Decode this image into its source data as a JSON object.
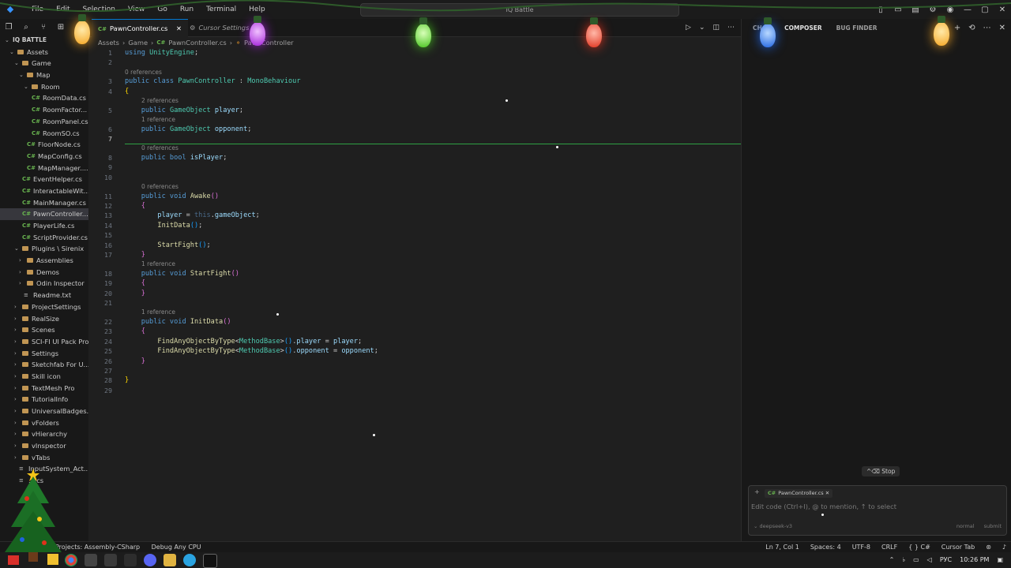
{
  "titlebar": {
    "menu": [
      "File",
      "Edit",
      "Selection",
      "View",
      "Go",
      "Run",
      "Terminal",
      "Help"
    ],
    "search": "IQ Battle"
  },
  "explorer": {
    "rows": [
      {
        "indent": 0,
        "kind": "root",
        "label": "IQ BATTLE",
        "open": true
      },
      {
        "indent": 1,
        "kind": "folder",
        "label": "Assets",
        "open": true
      },
      {
        "indent": 2,
        "kind": "folder",
        "label": "Game",
        "open": true
      },
      {
        "indent": 3,
        "kind": "folder",
        "label": "Map",
        "open": true
      },
      {
        "indent": 4,
        "kind": "folder",
        "label": "Room",
        "open": true
      },
      {
        "indent": 5,
        "kind": "cs",
        "label": "RoomData.cs"
      },
      {
        "indent": 5,
        "kind": "cs",
        "label": "RoomFactor..."
      },
      {
        "indent": 5,
        "kind": "cs",
        "label": "RoomPanel.cs"
      },
      {
        "indent": 5,
        "kind": "cs",
        "label": "RoomSO.cs"
      },
      {
        "indent": 4,
        "kind": "cs",
        "label": "FloorNode.cs"
      },
      {
        "indent": 4,
        "kind": "cs",
        "label": "MapConfig.cs"
      },
      {
        "indent": 4,
        "kind": "cs",
        "label": "MapManager...."
      },
      {
        "indent": 3,
        "kind": "cs",
        "label": "EventHelper.cs"
      },
      {
        "indent": 3,
        "kind": "cs",
        "label": "InteractableWit..."
      },
      {
        "indent": 3,
        "kind": "cs",
        "label": "MainManager.cs"
      },
      {
        "indent": 3,
        "kind": "cs",
        "label": "PawnController...",
        "selected": true
      },
      {
        "indent": 3,
        "kind": "cs",
        "label": "PlayerLife.cs"
      },
      {
        "indent": 3,
        "kind": "cs",
        "label": "ScriptProvider.cs"
      },
      {
        "indent": 2,
        "kind": "folder",
        "label": "Plugins \\ Sirenix",
        "open": true
      },
      {
        "indent": 3,
        "kind": "folder",
        "label": "Assemblies"
      },
      {
        "indent": 3,
        "kind": "folder",
        "label": "Demos"
      },
      {
        "indent": 3,
        "kind": "folder",
        "label": "Odin Inspector"
      },
      {
        "indent": 3,
        "kind": "file",
        "label": "Readme.txt"
      },
      {
        "indent": 2,
        "kind": "folder",
        "label": "ProjectSettings"
      },
      {
        "indent": 2,
        "kind": "folder",
        "label": "RealSize"
      },
      {
        "indent": 2,
        "kind": "folder",
        "label": "Scenes"
      },
      {
        "indent": 2,
        "kind": "folder",
        "label": "SCI-FI UI Pack Pro"
      },
      {
        "indent": 2,
        "kind": "folder",
        "label": "Settings"
      },
      {
        "indent": 2,
        "kind": "folder",
        "label": "Sketchfab For U..."
      },
      {
        "indent": 2,
        "kind": "folder",
        "label": "Skill icon"
      },
      {
        "indent": 2,
        "kind": "folder",
        "label": "TextMesh Pro"
      },
      {
        "indent": 2,
        "kind": "folder",
        "label": "TutorialInfo"
      },
      {
        "indent": 2,
        "kind": "folder",
        "label": "UniversalBadges..."
      },
      {
        "indent": 2,
        "kind": "folder",
        "label": "vFolders"
      },
      {
        "indent": 2,
        "kind": "folder",
        "label": "vHierarchy"
      },
      {
        "indent": 2,
        "kind": "folder",
        "label": "vInspector"
      },
      {
        "indent": 2,
        "kind": "folder",
        "label": "vTabs"
      },
      {
        "indent": 2,
        "kind": "file",
        "label": "InputSystem_Act..."
      },
      {
        "indent": 2,
        "kind": "file",
        "label": "...ics"
      }
    ]
  },
  "tabs": {
    "active": "PawnController.cs",
    "inactive": "Cursor Settings"
  },
  "breadcrumb": [
    "Assets",
    "Game",
    "PawnController.cs",
    "PawnController"
  ],
  "editor": {
    "lines": [
      {
        "n": "1",
        "html": "<span class=\"kw\">using</span> <span class=\"ty\">UnityEngine</span>;"
      },
      {
        "n": "2",
        "html": ""
      },
      {
        "n": "3",
        "lens": "0 references",
        "html": "<span class=\"kw\">public class</span> <span class=\"ty\">PawnController</span> : <span class=\"ty\">MonoBehaviour</span>"
      },
      {
        "n": "4",
        "html": "<span class=\"br\">{</span>"
      },
      {
        "n": "5",
        "lens": "2 references",
        "html": "    <span class=\"kw\">public</span> <span class=\"ty\">GameObject</span> <span class=\"var\">player</span>;"
      },
      {
        "n": "6",
        "lens": "1 reference",
        "html": "    <span class=\"kw\">public</span> <span class=\"ty\">GameObject</span> <span class=\"var\">opponent</span>;"
      },
      {
        "n": "7",
        "html": "",
        "current": true
      },
      {
        "n": "8",
        "lens": "0 references",
        "html": "    <span class=\"kw\">public bool</span> <span class=\"var\">isPlayer</span>;"
      },
      {
        "n": "9",
        "html": ""
      },
      {
        "n": "10",
        "html": ""
      },
      {
        "n": "11",
        "lens": "0 references",
        "html": "    <span class=\"kw\">public void</span> <span class=\"fn\">Awake</span><span class=\"br2\">()</span>"
      },
      {
        "n": "12",
        "html": "    <span class=\"br2\">{</span>"
      },
      {
        "n": "13",
        "html": "        <span class=\"var\">player</span> = <span class=\"dim\">this</span>.<span class=\"var\">gameObject</span>;"
      },
      {
        "n": "14",
        "html": "        <span class=\"fn\">InitData</span><span class=\"br3\">()</span>;"
      },
      {
        "n": "15",
        "html": ""
      },
      {
        "n": "16",
        "html": "        <span class=\"fn\">StartFight</span><span class=\"br3\">()</span>;"
      },
      {
        "n": "17",
        "html": "    <span class=\"br2\">}</span>"
      },
      {
        "n": "18",
        "lens": "1 reference",
        "html": "    <span class=\"kw\">public void</span> <span class=\"fn\">StartFight</span><span class=\"br2\">()</span>"
      },
      {
        "n": "19",
        "html": "    <span class=\"br2\">{</span>"
      },
      {
        "n": "20",
        "html": "    <span class=\"br2\">}</span>"
      },
      {
        "n": "21",
        "html": ""
      },
      {
        "n": "22",
        "lens": "1 reference",
        "html": "    <span class=\"kw\">public void</span> <span class=\"fn\">InitData</span><span class=\"br2\">()</span>"
      },
      {
        "n": "23",
        "html": "    <span class=\"br2\">{</span>"
      },
      {
        "n": "24",
        "html": "        <span class=\"fn\">FindAnyObjectByType</span>&lt;<span class=\"ty\">MethodBase</span>&gt;<span class=\"br3\">()</span>.<span class=\"var\">player</span> = <span class=\"var\">player</span>;"
      },
      {
        "n": "25",
        "html": "        <span class=\"fn\">FindAnyObjectByType</span>&lt;<span class=\"ty\">MethodBase</span>&gt;<span class=\"br3\">()</span>.<span class=\"var\">opponent</span> = <span class=\"var\">opponent</span>;"
      },
      {
        "n": "26",
        "html": "    <span class=\"br2\">}</span>"
      },
      {
        "n": "27",
        "html": ""
      },
      {
        "n": "28",
        "html": "<span class=\"br\">}</span>"
      },
      {
        "n": "29",
        "html": ""
      }
    ]
  },
  "rightpanel": {
    "tabs": [
      "CHAT",
      "COMPOSER",
      "BUG FINDER"
    ],
    "active_tab": "COMPOSER",
    "stop_label": "^⌫ Stop",
    "context_file": "PawnController.cs",
    "input_placeholder": "Edit code (Ctrl+I), @ to mention, ↑ to select",
    "model": "deepseek-v3",
    "mode": "normal",
    "submit": "submit"
  },
  "statusbar": {
    "left": [
      "Projects: Assembly-CSharp",
      "Debug Any CPU"
    ],
    "right": [
      "Ln 7, Col 1",
      "Spaces: 4",
      "UTF-8",
      "CRLF",
      "{ } C#",
      "Cursor Tab"
    ]
  },
  "taskbar": {
    "lang": "РУС",
    "time": "10:26 PM"
  },
  "colors": {
    "accent": "#0078d4",
    "cs_icon": "#68b34f",
    "folder": "#c09553"
  }
}
